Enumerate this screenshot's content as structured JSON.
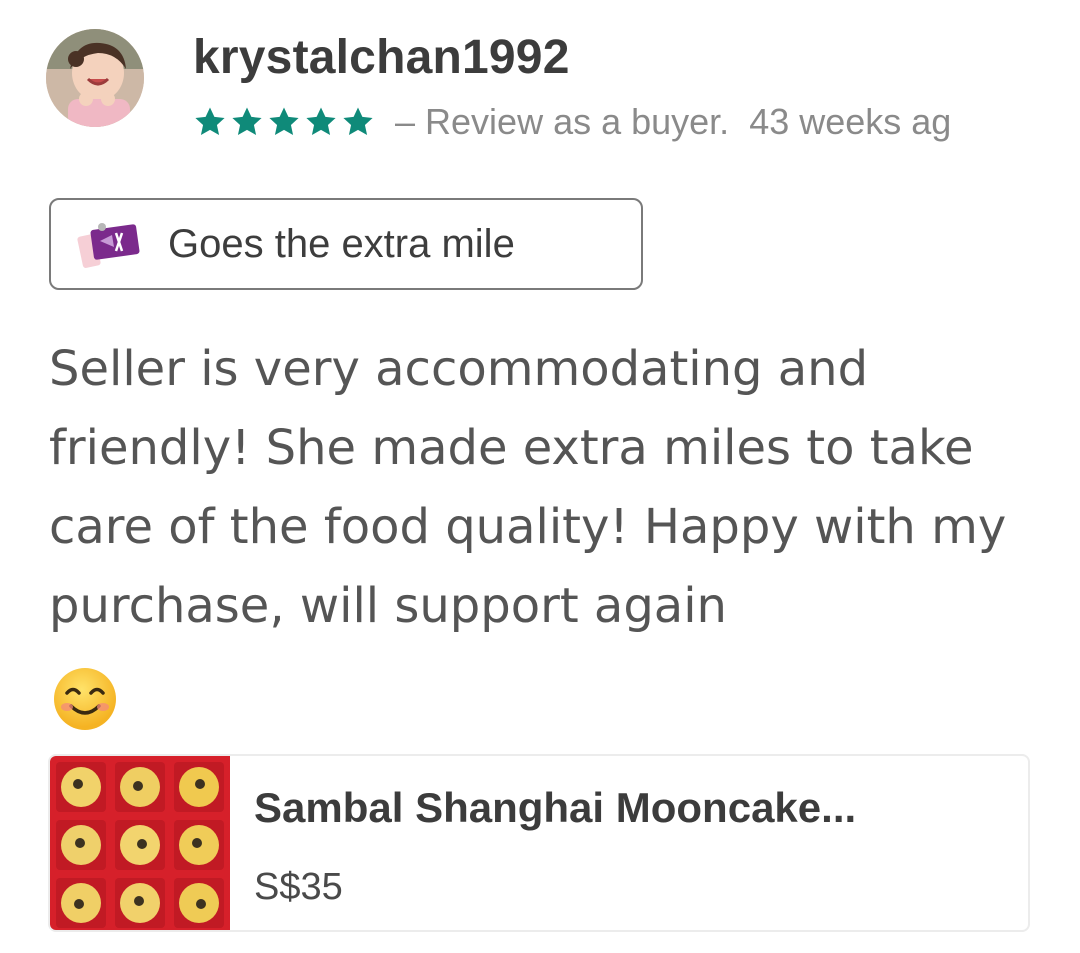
{
  "review": {
    "username": "krystalchan1992",
    "rating": 5,
    "rating_max": 5,
    "dash": "–",
    "review_type": "Review as a buyer.",
    "age": "43 weeks ag",
    "badge_label": "Goes the extra mile",
    "badge_icon": "gift-voucher-icon",
    "text": "Seller is very accommodating and friendly! She made extra miles to take care of the food quality! Happy with my purchase, will support again",
    "emoji": "smiling-face-icon"
  },
  "product": {
    "title": "Sambal Shanghai Mooncake...",
    "price": "S$35",
    "thumbnail_icon": "mooncake-box-thumbnail"
  },
  "colors": {
    "star": "#0f8a79",
    "meta_text": "#8a8a8a",
    "badge_border": "#7a7a7a",
    "thumb_red": "#d6202a"
  }
}
